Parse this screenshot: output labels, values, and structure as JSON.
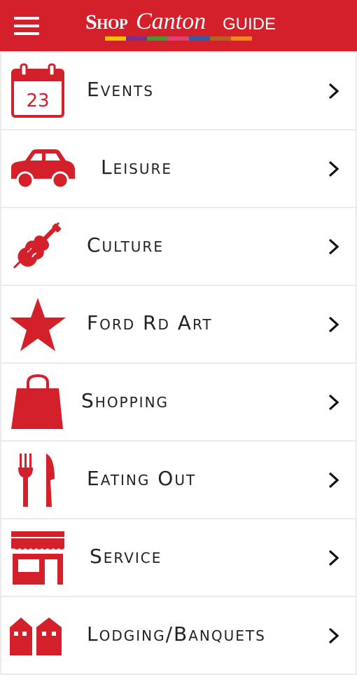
{
  "header": {
    "logo_shop": "Shop",
    "logo_canton": "Canton",
    "logo_guide": "GUIDE",
    "menu_icon": "hamburger-menu-icon",
    "stripe_colors": [
      "#f5c000",
      "#7a2f8e",
      "#3f9a35",
      "#e0407a",
      "#1f62b0",
      "#b2641f",
      "#f08a1c"
    ]
  },
  "colors": {
    "accent": "#d4202a",
    "divider": "#ebebeb",
    "text": "#222222"
  },
  "menu": {
    "items": [
      {
        "label": "Events",
        "icon": "calendar-icon",
        "calendar_day": "23"
      },
      {
        "label": "Leisure",
        "icon": "car-icon"
      },
      {
        "label": "Culture",
        "icon": "violin-icon"
      },
      {
        "label": "Ford Rd Art",
        "icon": "star-icon"
      },
      {
        "label": "Shopping",
        "icon": "shopping-bag-icon"
      },
      {
        "label": "Eating Out",
        "icon": "fork-knife-icon"
      },
      {
        "label": "Service",
        "icon": "storefront-icon"
      },
      {
        "label": "Lodging/Banquets",
        "icon": "houses-icon"
      }
    ],
    "chevron_icon": "chevron-right-icon"
  }
}
